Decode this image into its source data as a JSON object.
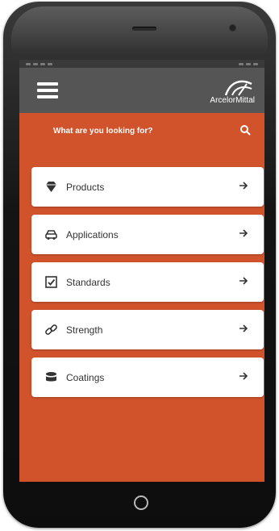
{
  "app": {
    "brand": "ArcelorMittal"
  },
  "search": {
    "placeholder": "What are you looking for?"
  },
  "menu": [
    {
      "label": "Products",
      "icon": "diamond-icon"
    },
    {
      "label": "Applications",
      "icon": "car-icon"
    },
    {
      "label": "Standards",
      "icon": "checkbox-icon"
    },
    {
      "label": "Strength",
      "icon": "link-icon"
    },
    {
      "label": "Coatings",
      "icon": "layers-icon"
    }
  ],
  "colors": {
    "accent": "#d0532c",
    "header": "#555555",
    "card": "#ffffff"
  }
}
